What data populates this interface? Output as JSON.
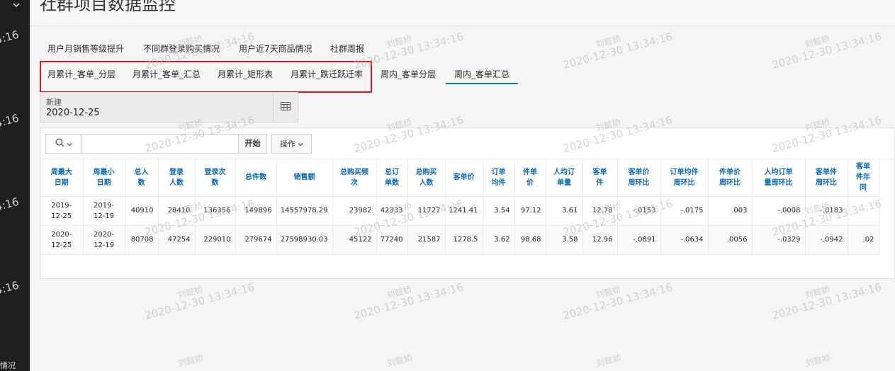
{
  "sidebar": {
    "bottom_text": "情况"
  },
  "page": {
    "title": "社群项目数据监控"
  },
  "tabs_row1": [
    {
      "label": "用户月销售等级提升"
    },
    {
      "label": "不同群登录购买情况"
    },
    {
      "label": "用户近7天商品情况"
    },
    {
      "label": "社群周报"
    }
  ],
  "tabs_row2": [
    {
      "label": "月累计_客单_分层"
    },
    {
      "label": "月累计_客单_汇总"
    },
    {
      "label": "月累计_矩形表"
    },
    {
      "label": "月累计_跌迁跃迁率"
    },
    {
      "label": "周内_客单分层"
    },
    {
      "label": "周内_客单汇总",
      "active": true
    }
  ],
  "date_field": {
    "label": "新建",
    "value": "2020-12-25"
  },
  "toolbar": {
    "search_value": "",
    "go_label": "开始",
    "actions_label": "操作"
  },
  "table": {
    "columns": [
      "周最大日期",
      "周最小日期",
      "总人数",
      "登录人数",
      "登录次数",
      "总件数",
      "销售额",
      "总购买频次",
      "总订单数",
      "总购买人数",
      "客单价",
      "订单均件",
      "件单价",
      "人均订单量",
      "客单件",
      "客单价周环比",
      "订单均件周环比",
      "件单价周环比",
      "人均订单量周环比",
      "客单件周环比",
      "客单件年同"
    ],
    "rows": [
      [
        "2019-12-25",
        "2019-12-19",
        "40910",
        "28410",
        "136356",
        "149896",
        "14557978.29",
        "23982",
        "42333",
        "11727",
        "1241.41",
        "3.54",
        "97.12",
        "3.61",
        "12.78",
        "-.0153",
        "-.0175",
        ".003",
        "-.0008",
        "-.0183",
        ""
      ],
      [
        "2020-12-25",
        "2020-12-19",
        "80708",
        "47254",
        "229010",
        "279674",
        "27598930.03",
        "45122",
        "77240",
        "21587",
        "1278.5",
        "3.62",
        "98.68",
        "3.58",
        "12.96",
        "-.0891",
        "-.0634",
        ".0056",
        "-.0329",
        "-.0942",
        ".02"
      ]
    ]
  },
  "watermark": {
    "name": "刘懿娇",
    "time": "2020-12-30 13:34:16",
    "time_short": "13:34:16"
  },
  "colors": {
    "accent": "#0572ce",
    "highlight": "#e0141e",
    "header_text": "#0b6ab8"
  },
  "icons": {
    "search": "search-icon",
    "calendar": "calendar-icon",
    "chevron": "chevron-down-icon"
  }
}
